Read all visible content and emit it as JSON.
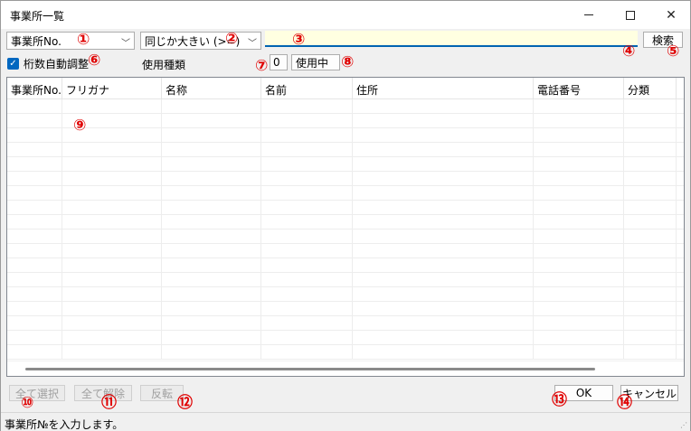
{
  "window": {
    "title": "事業所一覧",
    "minimize_icon": "minimize-icon",
    "maximize_icon": "maximize-icon",
    "close_icon": "close-icon"
  },
  "filters": {
    "field_select": "事業所No.",
    "operator_select": "同じか大きい (>=)",
    "search_value": "",
    "search_button": "検索",
    "auto_adjust_label": "桁数自動調整",
    "auto_adjust_checked": true,
    "usage_type_label": "使用種類",
    "usage_type_code": "0",
    "usage_type_value": "使用中"
  },
  "grid": {
    "columns": [
      "事業所No.",
      "フリガナ",
      "名称",
      "名前",
      "住所",
      "電話番号",
      "分類"
    ],
    "rows": []
  },
  "footer": {
    "select_all": "全て選択",
    "deselect_all": "全て解除",
    "invert": "反転",
    "ok": "OK",
    "cancel": "キャンセル"
  },
  "status": {
    "message": "事業所№を入力します。"
  },
  "annotations": [
    "①",
    "②",
    "③",
    "④",
    "⑤",
    "⑥",
    "⑦",
    "⑧",
    "⑨",
    "⑩",
    "⑪",
    "⑫",
    "⑬",
    "⑭"
  ],
  "colors": {
    "annotation": "#e00000",
    "accent": "#0063b1",
    "input_bg": "#ffffe1"
  }
}
